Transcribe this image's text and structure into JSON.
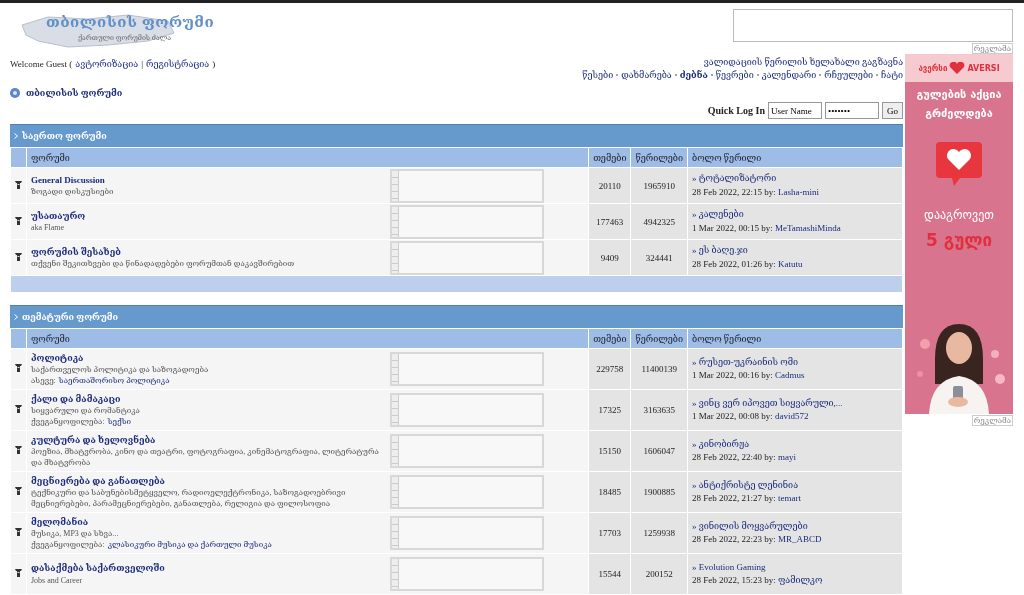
{
  "logo": {
    "title": "თბილისის ფორუმი",
    "subtitle": "ქართული ფორუმის ძალა"
  },
  "top_ad": {
    "label": "რეკლამა"
  },
  "welcome": {
    "text": "Welcome Guest (",
    "login": "ავტორიზაცია",
    "separator": "|",
    "register": "რეგისტრაცია",
    "close": ")"
  },
  "resend_link": "ვალიდაციის წერილის ხელახალი გაგზავნა",
  "nav": [
    {
      "label": "წესები",
      "selected": false
    },
    {
      "label": "დახმარება",
      "selected": false
    },
    {
      "label": "ძებნა",
      "selected": true
    },
    {
      "label": "წევრები",
      "selected": false
    },
    {
      "label": "კალენდარი",
      "selected": false
    },
    {
      "label": "რჩეულები",
      "selected": false
    },
    {
      "label": "ჩატი",
      "selected": false
    }
  ],
  "breadcrumb": "თბილისის ფორუმი",
  "quick_login": {
    "label": "Quick Log In",
    "username": "User Name",
    "password": "•••••••",
    "button": "Go"
  },
  "sections": [
    {
      "title": "საერთო ფორუმი",
      "columns": [
        "ფორუმი",
        "თემები",
        "წერილები",
        "ბოლო წერილი"
      ],
      "forums": [
        {
          "name": "General Discussion",
          "description": "ზოგადი დისკუსიები",
          "topics": "20110",
          "posts": "1965910",
          "last_post": {
            "title": "» ტოტალიზატორი",
            "date": "28 Feb 2022, 22:15 by:",
            "author": "Lasha-mini"
          }
        },
        {
          "name": "უსათაურო",
          "description": "aka Flame",
          "topics": "177463",
          "posts": "4942325",
          "last_post": {
            "title": "» კალენები",
            "date": "1 Mar 2022, 00:15 by:",
            "author": "MeTamashiMinda"
          }
        },
        {
          "name": "ფორუმის შესახებ",
          "description": "თქვენი შეკითხვები და წინადადებები ფორუმთან დაკავშირებით",
          "topics": "9409",
          "posts": "324441",
          "last_post": {
            "title": "» ეს ბაღე.ჯი",
            "date": "28 Feb 2022, 01:26 by:",
            "author": "Katutu"
          }
        }
      ]
    },
    {
      "title": "თემატური ფორუმი",
      "columns": [
        "ფორუმი",
        "თემები",
        "წერილები",
        "ბოლო წერილი"
      ],
      "forums": [
        {
          "name": "პოლიტიკა",
          "description": "საქართველოს პოლიტიკა და საზოგადოება",
          "subforum_label": "ასევე:",
          "subforum": "საერთაშორისო პოლიტიკა",
          "topics": "229758",
          "posts": "11400139",
          "last_post": {
            "title": "» რუსეთ-უკრაინის ომი",
            "date": "1 Mar 2022, 00:16 by:",
            "author": "Cadmus"
          }
        },
        {
          "name": "ქალი და მამაკაცი",
          "description": "სიყვარული და რომანტიკა",
          "subforum_label": "ქვეგანყოფილება:",
          "subforum": "სექსი",
          "topics": "17325",
          "posts": "3163635",
          "last_post": {
            "title": "» ვინც ვერ იპოვეთ სიყვარული,...",
            "date": "1 Mar 2022, 00:08 by:",
            "author": "david572"
          }
        },
        {
          "name": "კულტურა და ხელოვნება",
          "description": "პოეზია, მხატვრობა, კინო და თეატრი, ფოტოგრაფია, კინემატოგრაფია, ლიტერატურა და მხატვრობა",
          "topics": "15150",
          "posts": "1606047",
          "last_post": {
            "title": "» კინობირჟა",
            "date": "28 Feb 2022, 22:40 by:",
            "author": "mayi"
          }
        },
        {
          "name": "მეცნიერება და განათლება",
          "description": "ტექნიკური და საბუნებისმეტყველო, რადიოელექტრონიკა, საზოგადოებრივი მეცნიერებები, პარამეცნიერებები, განათლება, რელიგია და ფილოსოფია",
          "topics": "18485",
          "posts": "1900885",
          "last_post": {
            "title": "» ანტიქრისტე ლენინია",
            "date": "28 Feb 2022, 21:27 by:",
            "author": "temart"
          }
        },
        {
          "name": "მელომანია",
          "description": "მუსიკა, MP3 და სხვა...",
          "subforum_label": "ქვეგანყოფილება:",
          "subforum": "კლასიკური მუსიკა და ქართული მუსიკა",
          "topics": "17703",
          "posts": "1259938",
          "last_post": {
            "title": "» ვინილის მოყვარულები",
            "date": "28 Feb 2022, 22:23 by:",
            "author": "MR_ABCD"
          }
        },
        {
          "name": "დასაქმება საქართველოში",
          "description": "Jobs and Career",
          "topics": "15544",
          "posts": "200152",
          "last_post": {
            "title": "» Evolution Gaming",
            "date": "28 Feb 2022, 15:23 by:",
            "author": "ფამილკო"
          }
        }
      ]
    }
  ],
  "side_ad": {
    "brand_local": "ავერსი",
    "brand": "AVERSI",
    "headline": [
      "გულების აქცია",
      "გრძელდება"
    ],
    "call": "დააგროვეთ",
    "offer": "5 გული",
    "label": "რეკლამა"
  }
}
